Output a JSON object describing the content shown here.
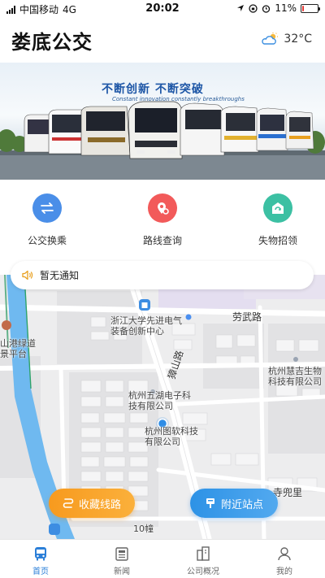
{
  "status_bar": {
    "carrier": "中国移动",
    "network": "4G",
    "time": "20:02",
    "battery": "11%",
    "battery_level": 0.11
  },
  "header": {
    "title": "娄底公交",
    "temperature": "32°C",
    "weather_icon": "partly-cloudy-icon"
  },
  "banner": {
    "slogan": "不断创新 不断突破",
    "slogan_en": "Constant innovation constantly breakthroughs"
  },
  "quick_actions": [
    {
      "label": "公交换乘",
      "icon": "transfer-icon",
      "color": "#4a8ee8"
    },
    {
      "label": "路线查询",
      "icon": "route-search-icon",
      "color": "#f25a5a"
    },
    {
      "label": "失物招领",
      "icon": "lost-found-icon",
      "color": "#3cc0a3"
    }
  ],
  "notice": {
    "text": "暂无通知"
  },
  "map": {
    "labels": {
      "zju": "浙江大学先进电气装备创新中心",
      "lao_wu_road": "劳武路",
      "zhang_shan_road": "獐山路",
      "green_way": "山港绿道景平台",
      "huiji": "杭州慧吉生物科技有限公司",
      "wuhu": "杭州五湖电子科技有限公司",
      "turuan": "杭州图软科技有限公司",
      "si_dou_li": "寺兜里",
      "building_10": "10幢"
    }
  },
  "buttons": {
    "favorite_routes": "收藏线路",
    "nearby_stops": "附近站点"
  },
  "tabs": [
    {
      "label": "首页",
      "icon": "bus-home-icon",
      "active": true
    },
    {
      "label": "新闻",
      "icon": "news-icon",
      "active": false
    },
    {
      "label": "公司概况",
      "icon": "company-icon",
      "active": false
    },
    {
      "label": "我的",
      "icon": "profile-icon",
      "active": false
    }
  ],
  "colors": {
    "accent": "#2b7fd8",
    "orange": "#f79a1e",
    "blue": "#2d92e6"
  }
}
